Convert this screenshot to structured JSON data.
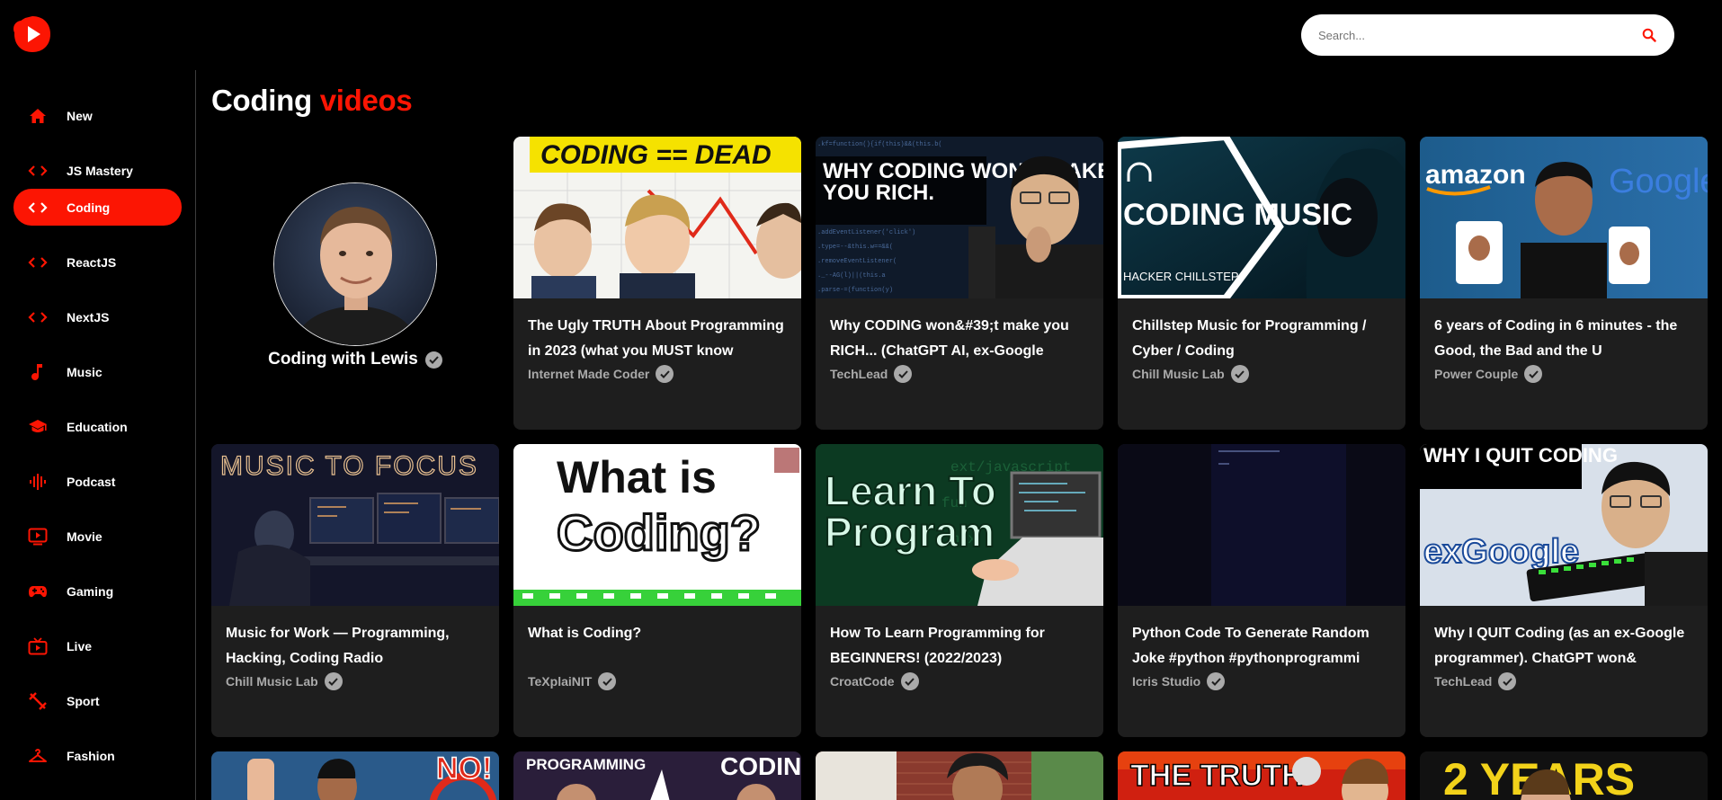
{
  "app": {
    "name": "YouTube"
  },
  "search": {
    "placeholder": "Search..."
  },
  "sidebar": {
    "items": [
      {
        "label": "New",
        "icon": "home-icon"
      },
      {
        "label": "JS Mastery",
        "icon": "code-icon"
      },
      {
        "label": "Coding",
        "icon": "code-icon",
        "active": true
      },
      {
        "label": "ReactJS",
        "icon": "code-icon"
      },
      {
        "label": "NextJS",
        "icon": "code-icon"
      },
      {
        "label": "Music",
        "icon": "music-note-icon"
      },
      {
        "label": "Education",
        "icon": "school-icon"
      },
      {
        "label": "Podcast",
        "icon": "podcast-icon"
      },
      {
        "label": "Movie",
        "icon": "movie-icon"
      },
      {
        "label": "Gaming",
        "icon": "gamepad-icon"
      },
      {
        "label": "Live",
        "icon": "live-tv-icon"
      },
      {
        "label": "Sport",
        "icon": "sport-icon"
      },
      {
        "label": "Fashion",
        "icon": "hanger-icon"
      }
    ]
  },
  "page": {
    "title_main": "Coding",
    "title_accent": "videos"
  },
  "channel": {
    "name": "Coding with Lewis"
  },
  "videos": [
    {
      "title": "The Ugly TRUTH About Programming in 2023 (what you MUST know",
      "channel": "Internet Made Coder",
      "thumb_text": "CODING == DEAD"
    },
    {
      "title": "Why CODING won&#39;t make you RICH... (ChatGPT AI, ex-Google",
      "channel": "TechLead",
      "thumb_text": "WHY CODING WON'T MAKE YOU RICH."
    },
    {
      "title": "Chillstep Music for Programming / Cyber / Coding",
      "channel": "Chill Music Lab",
      "thumb_text": "CODING MUSIC",
      "thumb_sub": "HACKER CHILLSTEP"
    },
    {
      "title": "6 years of Coding in 6 minutes - the Good, the Bad and the U",
      "channel": "Power Couple",
      "thumb_text": "amazon",
      "thumb_text2": "Google"
    },
    {
      "title": "Music for Work — Programming, Hacking, Coding Radio",
      "channel": "Chill Music Lab",
      "thumb_text": "MUSIC TO FOCUS"
    },
    {
      "title": "What is Coding?",
      "channel": "TeXplaiNIT",
      "thumb_text": "What is",
      "thumb_text2": "Coding?"
    },
    {
      "title": "How To Learn Programming for BEGINNERS! (2022/2023)",
      "channel": "CroatCode",
      "thumb_text": "Learn To Program"
    },
    {
      "title": "Python Code To Generate Random Joke #python #pythonprogrammi",
      "channel": "Icris Studio"
    },
    {
      "title": "Why I QUIT Coding (as an ex-Google programmer). ChatGPT won&",
      "channel": "TechLead",
      "thumb_text": "WHY I QUIT CODING",
      "thumb_text2": "exGoogle"
    }
  ],
  "row3_thumbs": [
    {
      "thumb_text": "NO!"
    },
    {
      "thumb_text": "PROGRAMMING",
      "thumb_text2": "CODIN"
    },
    {
      "thumb_text": ""
    },
    {
      "thumb_text": "THE TRUTH"
    },
    {
      "thumb_text": "2 YEARS"
    }
  ],
  "colors": {
    "accent": "#fc1503",
    "background": "#000000",
    "card": "#1e1e1e",
    "meta_text": "#aaaaaa"
  }
}
